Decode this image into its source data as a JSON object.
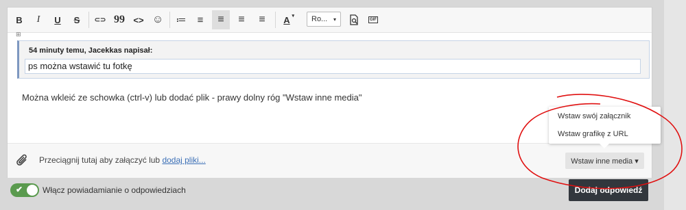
{
  "toolbar": {
    "buttons": [
      {
        "name": "bold",
        "glyph": "B"
      },
      {
        "name": "italic",
        "glyph": "I"
      },
      {
        "name": "underline",
        "glyph": "U"
      },
      {
        "name": "strikethrough",
        "glyph": "S"
      },
      {
        "name": "link",
        "glyph": "⊂⊃"
      },
      {
        "name": "quote",
        "glyph": "99"
      },
      {
        "name": "code",
        "glyph": "<>"
      },
      {
        "name": "emoji",
        "glyph": "☺"
      },
      {
        "name": "bulleted-list",
        "glyph": "≔"
      },
      {
        "name": "numbered-list",
        "glyph": "≡"
      },
      {
        "name": "align-left",
        "glyph": "≡"
      },
      {
        "name": "align-center",
        "glyph": "≡"
      },
      {
        "name": "align-right",
        "glyph": "≡"
      },
      {
        "name": "font-color",
        "glyph": "A"
      }
    ],
    "font_select": "Ro...",
    "extra_icons": [
      "preview-icon",
      "gif-icon"
    ],
    "gif_label": "GIF"
  },
  "quote": {
    "header": "54 minuty temu, Jacekkas napisał:",
    "body": "ps można wstawić tu fotkę"
  },
  "message": "Można wkleić ze schowka (ctrl-v) lub dodać plik - prawy dolny róg \"Wstaw inne media\"",
  "attach": {
    "prompt": "Przeciągnij tutaj aby załączyć lub",
    "link": "dodaj pliki..."
  },
  "media_button": "Wstaw inne media ▾",
  "dropdown": {
    "items": [
      "Wstaw swój załącznik",
      "Wstaw grafikę z URL"
    ]
  },
  "notify": {
    "label": "Włącz powiadamianie o odpowiedziach",
    "enabled": true
  },
  "submit_label": "Dodaj odpowiedź",
  "colors": {
    "accent_green": "#5a9a4e",
    "submit_bg": "#32373d",
    "link_blue": "#3b6fb6",
    "annotation_red": "#e01010"
  }
}
